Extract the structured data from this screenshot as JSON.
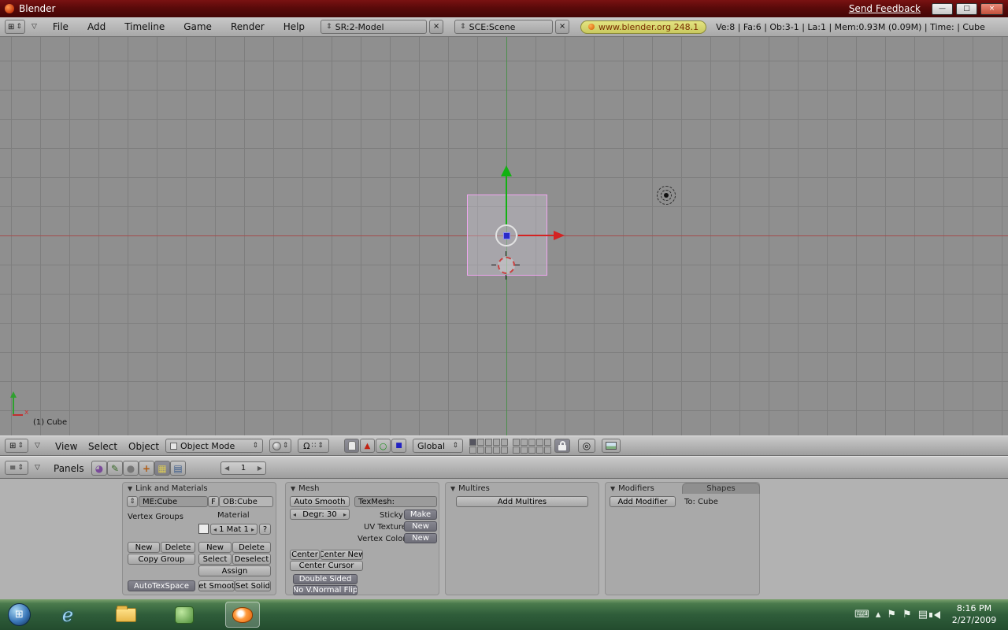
{
  "titlebar": {
    "title": "Blender",
    "send_feedback": "Send Feedback"
  },
  "menubar": {
    "menus": [
      "File",
      "Add",
      "Timeline",
      "Game",
      "Render",
      "Help"
    ],
    "screen": "SR:2-Model",
    "scene": "SCE:Scene",
    "version": "www.blender.org 248.1",
    "stats": "Ve:8 | Fa:6 | Ob:3-1 | La:1 | Mem:0.93M (0.09M) | Time: | Cube"
  },
  "viewport": {
    "object_info": "(1) Cube",
    "axis_label_x": "x"
  },
  "view3d_header": {
    "menus": [
      "View",
      "Select",
      "Object"
    ],
    "mode": "Object Mode",
    "orientation": "Global",
    "pivot_icon_glyph": "Ω"
  },
  "buttons_header": {
    "panels_label": "Panels",
    "frame": "1"
  },
  "link_panel": {
    "title": "Link and Materials",
    "me": "ME:Cube",
    "f": "F",
    "ob": "OB:Cube",
    "vertex_groups": "Vertex Groups",
    "material": "Material",
    "mat_count": "1 Mat 1",
    "help": "?",
    "new": "New",
    "delete": "Delete",
    "copy_group": "Copy Group",
    "select": "Select",
    "deselect": "Deselect",
    "assign": "Assign",
    "autotexspace": "AutoTexSpace",
    "set_smooth": "Set Smooth",
    "set_solid": "Set Solid"
  },
  "mesh_panel": {
    "title": "Mesh",
    "auto_smooth": "Auto Smooth",
    "degr": "Degr: 30",
    "texmesh": "TexMesh:",
    "sticky": "Sticky",
    "make": "Make",
    "uv_texture": "UV Texture",
    "new": "New",
    "vertex_color": "Vertex Color",
    "center": "Center",
    "center_new": "Center New",
    "center_cursor": "Center Cursor",
    "double_sided": "Double Sided",
    "no_vnormal_flip": "No V.Normal Flip"
  },
  "multires_panel": {
    "title": "Multires",
    "add_multires": "Add Multires"
  },
  "modifiers_panel": {
    "title": "Modifiers",
    "shapes_tab": "Shapes",
    "add_modifier": "Add Modifier",
    "to_target": "To: Cube"
  },
  "taskbar": {
    "time": "8:16 PM",
    "date": "2/27/2009"
  },
  "icons": {
    "updown": "⇕",
    "collapse": "▽",
    "panel_open": "▼",
    "close": "×",
    "minimize": "—",
    "maximize": "□",
    "grid_editor": "⊞",
    "list_editor": "≡",
    "step_left": "◂",
    "step_right": "▸",
    "arrow_left": "◀",
    "arrow_right": "▶",
    "logic": "◕",
    "script": "✎",
    "shading": "●",
    "object": "+",
    "editing": "▦",
    "scene": "▤",
    "dots": "∷",
    "magnet": "◎",
    "keyboard": "⌨",
    "chevron_up": "▴",
    "flag": "⚑",
    "network": "▤",
    "windows": "⊞"
  },
  "colors": {
    "titlebar_red": "#5a0a0a",
    "taskbar_green": "#2f5d3a",
    "selection_pink": "#f0a6f0",
    "axis_green": "#4d8f4d",
    "axis_red": "#a34e4e",
    "manipulator_green": "#12b212",
    "manipulator_red": "#d42222",
    "badge_yellow": "#d9d96d"
  }
}
